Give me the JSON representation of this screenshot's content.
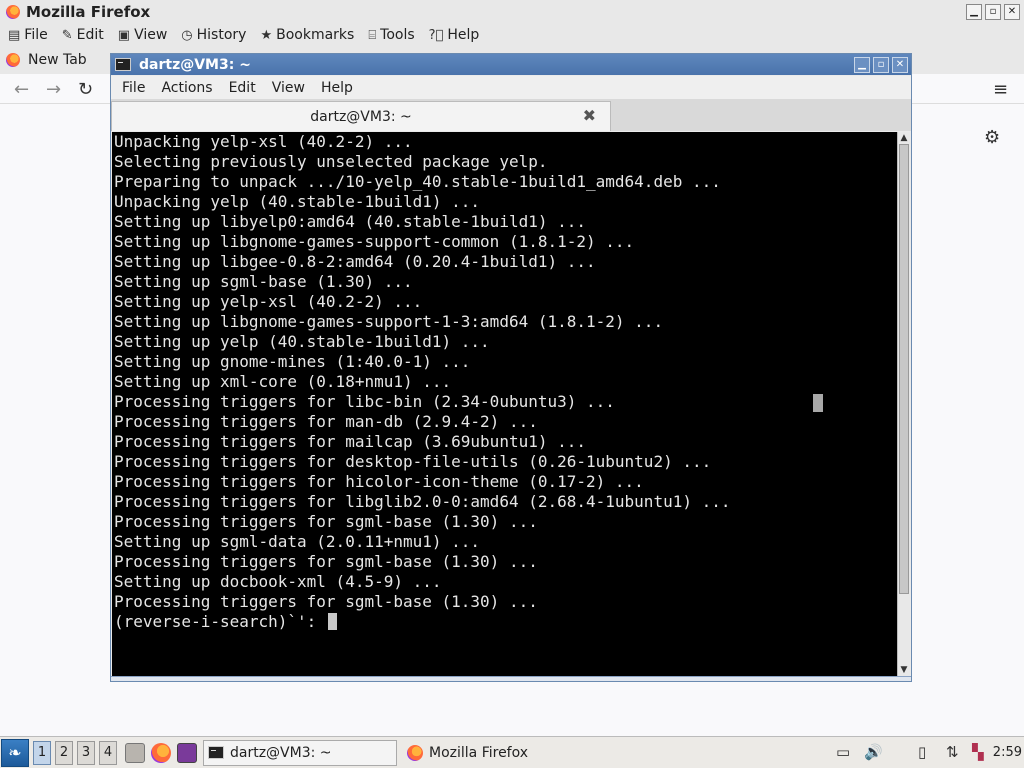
{
  "firefox": {
    "window_title": "Mozilla Firefox",
    "menu": [
      "File",
      "Edit",
      "View",
      "History",
      "Bookmarks",
      "Tools",
      "Help"
    ],
    "tab_title": "New Tab"
  },
  "terminal": {
    "window_title": "dartz@VM3: ~",
    "menu": [
      "File",
      "Actions",
      "Edit",
      "View",
      "Help"
    ],
    "tab_title": "dartz@VM3: ~",
    "lines": [
      "Unpacking yelp-xsl (40.2-2) ...",
      "Selecting previously unselected package yelp.",
      "Preparing to unpack .../10-yelp_40.stable-1build1_amd64.deb ...",
      "Unpacking yelp (40.stable-1build1) ...",
      "Setting up libyelp0:amd64 (40.stable-1build1) ...",
      "Setting up libgnome-games-support-common (1.8.1-2) ...",
      "Setting up libgee-0.8-2:amd64 (0.20.4-1build1) ...",
      "Setting up sgml-base (1.30) ...",
      "Setting up yelp-xsl (40.2-2) ...",
      "Setting up libgnome-games-support-1-3:amd64 (1.8.1-2) ...",
      "Setting up yelp (40.stable-1build1) ...",
      "Setting up gnome-mines (1:40.0-1) ...",
      "Setting up xml-core (0.18+nmu1) ...",
      "Processing triggers for libc-bin (2.34-0ubuntu3) ...",
      "Processing triggers for man-db (2.9.4-2) ...",
      "Processing triggers for mailcap (3.69ubuntu1) ...",
      "Processing triggers for desktop-file-utils (0.26-1ubuntu2) ...",
      "Processing triggers for hicolor-icon-theme (0.17-2) ...",
      "Processing triggers for libglib2.0-0:amd64 (2.68.4-1ubuntu1) ...",
      "Processing triggers for sgml-base (1.30) ...",
      "Setting up sgml-data (2.0.11+nmu1) ...",
      "Processing triggers for sgml-base (1.30) ...",
      "Setting up docbook-xml (4.5-9) ...",
      "Processing triggers for sgml-base (1.30) ..."
    ],
    "prompt": "(reverse-i-search)`': "
  },
  "taskbar": {
    "workspaces": [
      "1",
      "2",
      "3",
      "4"
    ],
    "tasks": [
      "dartz@VM3: ~",
      "Mozilla Firefox"
    ],
    "clock": "2:59"
  },
  "icons": {
    "menu": [
      "file-icon",
      "edit-pencil-icon",
      "view-icon",
      "history-clock-icon",
      "bookmarks-star-icon",
      "tools-icon",
      "help-icon"
    ]
  }
}
